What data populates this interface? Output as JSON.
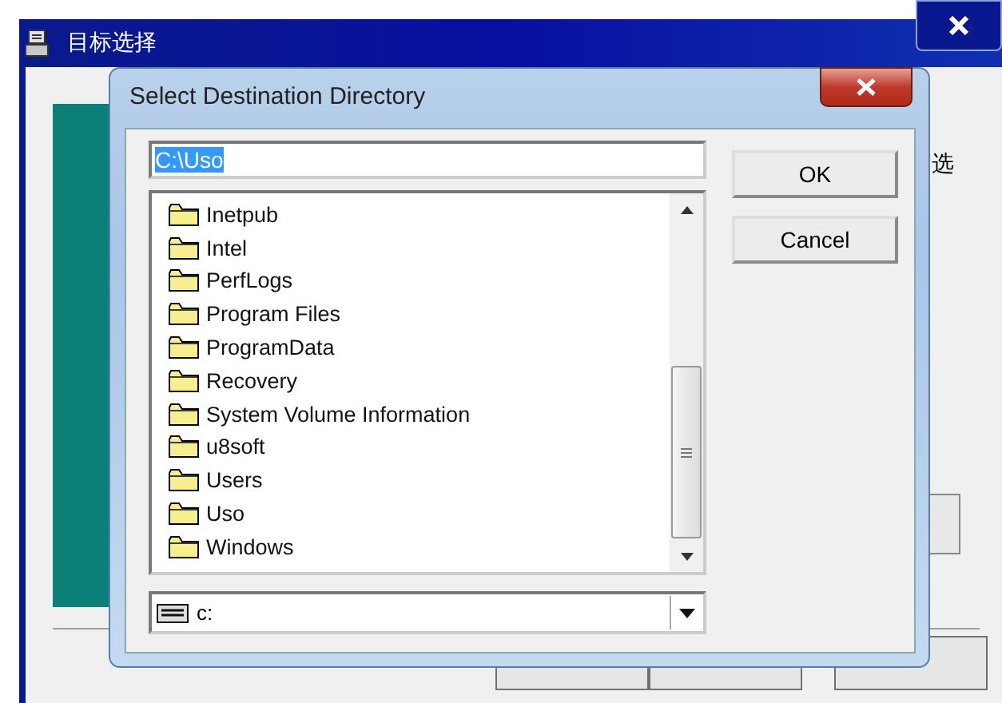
{
  "background_window": {
    "title": "目标选择",
    "side_text": "选"
  },
  "dialog": {
    "title": "Select Destination Directory",
    "path": "C:\\Uso",
    "path_selected": true,
    "folders": [
      {
        "name": "Inetpub"
      },
      {
        "name": "Intel"
      },
      {
        "name": "PerfLogs"
      },
      {
        "name": "Program Files"
      },
      {
        "name": "ProgramData"
      },
      {
        "name": "Recovery"
      },
      {
        "name": "System Volume Information"
      },
      {
        "name": "u8soft"
      },
      {
        "name": "Users"
      },
      {
        "name": "Uso"
      },
      {
        "name": "Windows"
      }
    ],
    "drive": "c:",
    "buttons": [
      "OK",
      "Cancel"
    ]
  }
}
